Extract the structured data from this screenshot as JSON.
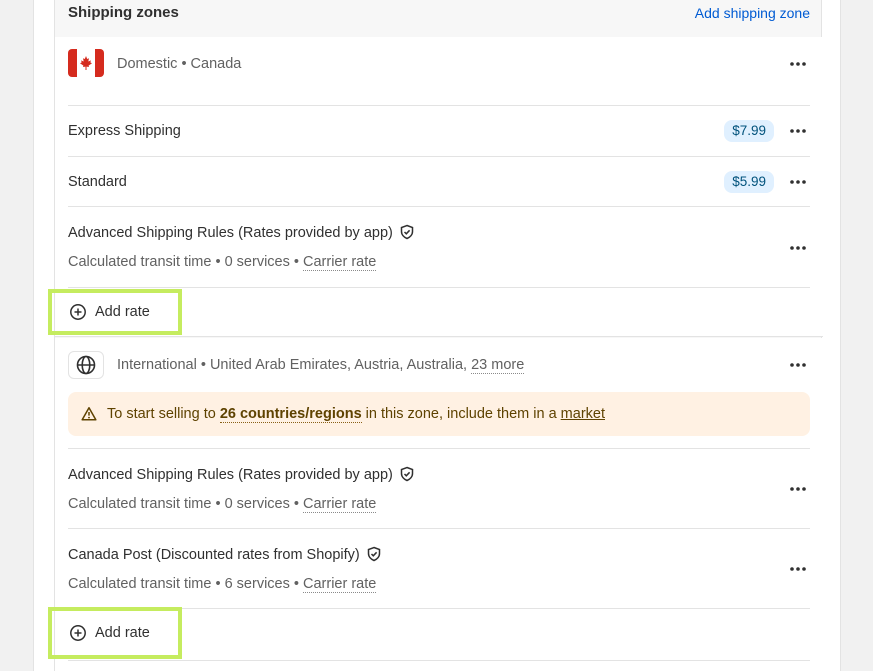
{
  "header": {
    "title": "Shipping zones",
    "add_zone": "Add shipping zone"
  },
  "zones": [
    {
      "icon": "canada-flag-icon",
      "label": "Domestic • Canada",
      "rates": [
        {
          "name": "Express Shipping",
          "price": "$7.99"
        },
        {
          "name": "Standard",
          "price": "$5.99"
        }
      ],
      "apps": [
        {
          "name": "Advanced Shipping Rules (Rates provided by app)",
          "details": "Calculated transit time • 0 services •",
          "carrier": "Carrier rate"
        }
      ],
      "add_rate": "Add rate"
    },
    {
      "icon": "globe-icon",
      "label": "International • United Arab Emirates, Austria, Australia,",
      "more": "23 more",
      "banner": {
        "prefix": "To start selling to",
        "highlight": "26 countries/regions",
        "middle": "in this zone, include them in a",
        "link": "market"
      },
      "apps": [
        {
          "name": "Advanced Shipping Rules (Rates provided by app)",
          "details": "Calculated transit time • 0 services •",
          "carrier": "Carrier rate"
        },
        {
          "name": "Canada Post (Discounted rates from Shopify)",
          "details": "Calculated transit time • 6 services •",
          "carrier": "Carrier rate"
        }
      ],
      "add_rate": "Add rate"
    }
  ],
  "colors": {
    "link": "#005bd3",
    "price_badge": "#e0f0ff",
    "banner": "#fff1e3",
    "highlight_outline": "#c5ec5f"
  }
}
